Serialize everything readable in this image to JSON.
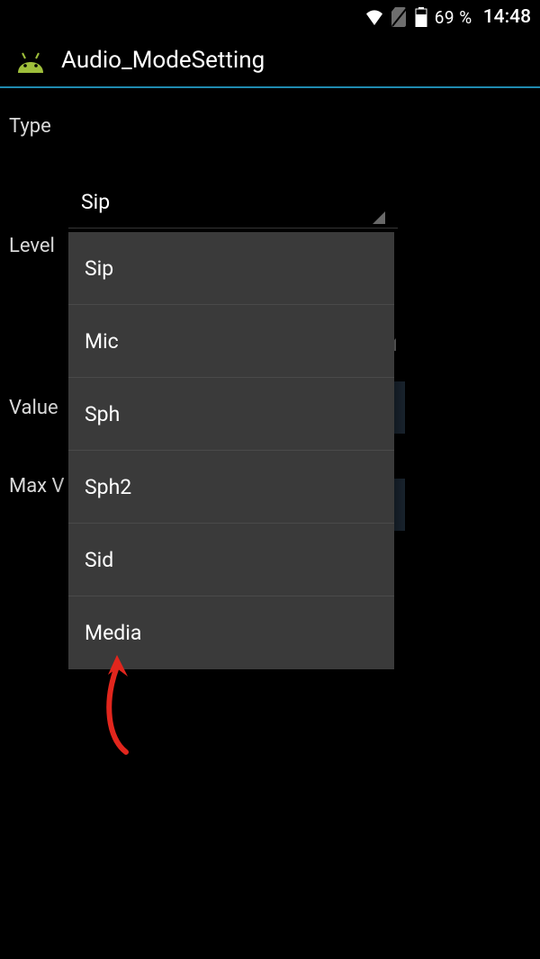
{
  "status": {
    "battery_percent": "69 %",
    "time": "14:48"
  },
  "app": {
    "title": "Audio_ModeSetting"
  },
  "form": {
    "type_label": "Type",
    "level_label": "Level",
    "value_label": "Value",
    "max_label": "Max V"
  },
  "type_spinner": {
    "selected": "Sip",
    "options": [
      "Sip",
      "Mic",
      "Sph",
      "Sph2",
      "Sid",
      "Media"
    ]
  }
}
